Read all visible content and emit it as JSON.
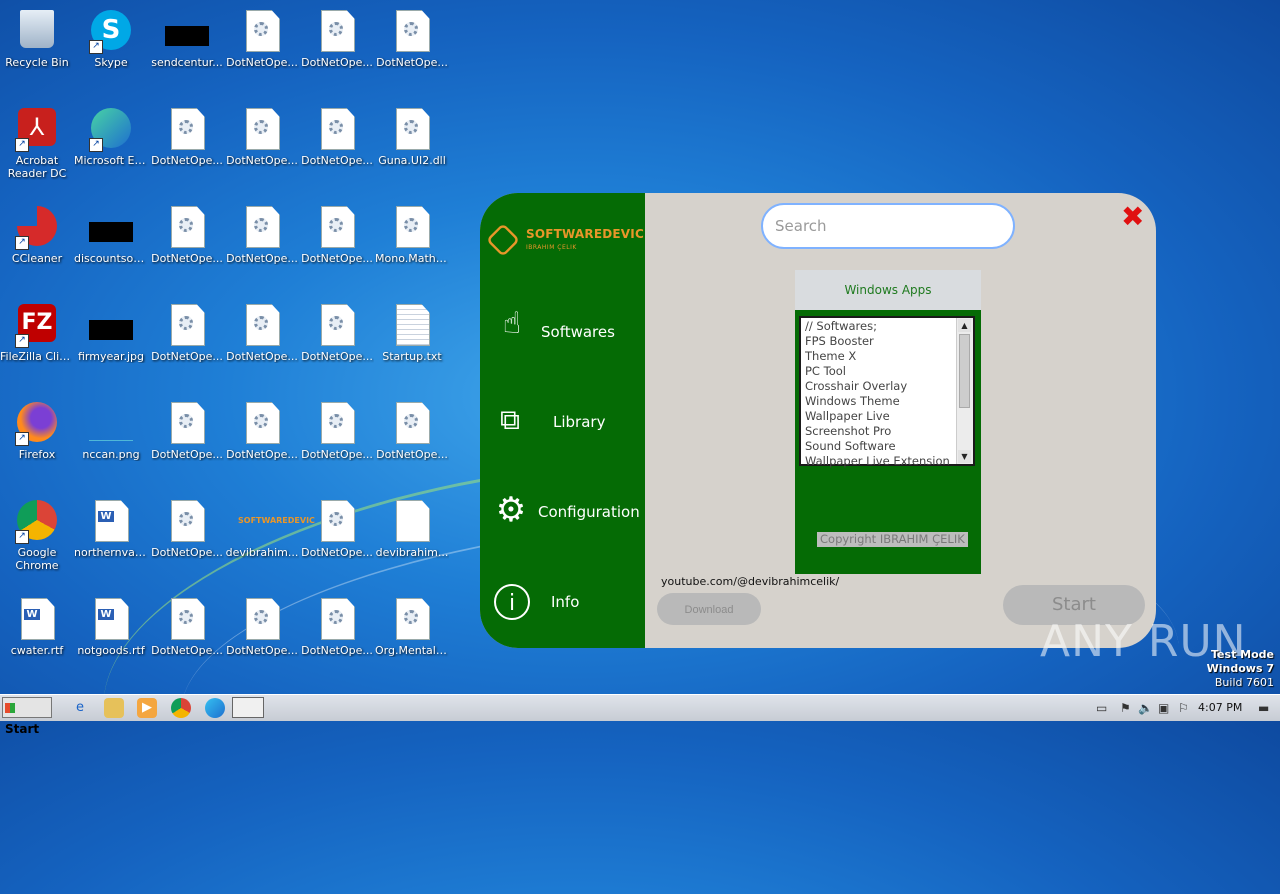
{
  "desktop": {
    "icons": [
      {
        "label": "Recycle Bin",
        "icon": "recycle-bin-icon"
      },
      {
        "label": "Skype",
        "icon": "skype-icon"
      },
      {
        "label": "sendcentur...",
        "icon": "image-file-icon"
      },
      {
        "label": "DotNetOpe...",
        "icon": "dll-file-icon"
      },
      {
        "label": "DotNetOpe...",
        "icon": "dll-file-icon"
      },
      {
        "label": "DotNetOpe...",
        "icon": "dll-file-icon"
      },
      {
        "label": "Acrobat Reader DC",
        "icon": "acrobat-icon"
      },
      {
        "label": "Microsoft Edge",
        "icon": "edge-icon"
      },
      {
        "label": "DotNetOpe...",
        "icon": "dll-file-icon"
      },
      {
        "label": "DotNetOpe...",
        "icon": "dll-file-icon"
      },
      {
        "label": "DotNetOpe...",
        "icon": "dll-file-icon"
      },
      {
        "label": "Guna.UI2.dll",
        "icon": "dll-file-icon"
      },
      {
        "label": "CCleaner",
        "icon": "ccleaner-icon"
      },
      {
        "label": "discountsom...",
        "icon": "image-file-icon"
      },
      {
        "label": "DotNetOpe...",
        "icon": "dll-file-icon"
      },
      {
        "label": "DotNetOpe...",
        "icon": "dll-file-icon"
      },
      {
        "label": "DotNetOpe...",
        "icon": "dll-file-icon"
      },
      {
        "label": "Mono.Math.dll",
        "icon": "dll-file-icon"
      },
      {
        "label": "FileZilla Client",
        "icon": "filezilla-icon"
      },
      {
        "label": "firmyear.jpg",
        "icon": "image-file-icon"
      },
      {
        "label": "DotNetOpe...",
        "icon": "dll-file-icon"
      },
      {
        "label": "DotNetOpe...",
        "icon": "dll-file-icon"
      },
      {
        "label": "DotNetOpe...",
        "icon": "dll-file-icon"
      },
      {
        "label": "Startup.txt",
        "icon": "text-file-icon"
      },
      {
        "label": "Firefox",
        "icon": "firefox-icon"
      },
      {
        "label": "nccan.png",
        "icon": "image-file-icon"
      },
      {
        "label": "DotNetOpe...",
        "icon": "dll-file-icon"
      },
      {
        "label": "DotNetOpe...",
        "icon": "dll-file-icon"
      },
      {
        "label": "DotNetOpe...",
        "icon": "dll-file-icon"
      },
      {
        "label": "DotNetOpe...",
        "icon": "dll-file-icon"
      },
      {
        "label": "Google Chrome",
        "icon": "chrome-icon"
      },
      {
        "label": "northernva.rtf",
        "icon": "word-doc-icon"
      },
      {
        "label": "DotNetOpe...",
        "icon": "dll-file-icon"
      },
      {
        "label": "devibrahim...",
        "icon": "image-file-icon"
      },
      {
        "label": "DotNetOpe...",
        "icon": "dll-file-icon"
      },
      {
        "label": "devibrahim...",
        "icon": "blank-file-icon"
      },
      {
        "label": "cwater.rtf",
        "icon": "word-doc-icon"
      },
      {
        "label": "notgoods.rtf",
        "icon": "word-doc-icon"
      },
      {
        "label": "DotNetOpe...",
        "icon": "dll-file-icon"
      },
      {
        "label": "DotNetOpe...",
        "icon": "dll-file-icon"
      },
      {
        "label": "DotNetOpe...",
        "icon": "dll-file-icon"
      },
      {
        "label": "Org.Mentali...",
        "icon": "dll-file-icon"
      }
    ]
  },
  "app": {
    "brand": {
      "name": "SOFTWAREDEVIC",
      "subtitle": "IBRAHIM ÇELIK",
      "logo_icon": "hexagon-logo-icon"
    },
    "nav": [
      {
        "label": "Softwares",
        "icon": "touch-hand-icon"
      },
      {
        "label": "Library",
        "icon": "puzzle-icon"
      },
      {
        "label": "Configuration",
        "icon": "gear-icon"
      },
      {
        "label": "Info",
        "icon": "info-icon"
      }
    ],
    "search": {
      "placeholder": "Search",
      "value": ""
    },
    "close_label": "✖",
    "panel": {
      "header": "Windows Apps",
      "list": [
        "// Softwares;",
        "FPS Booster",
        "Theme X",
        "PC Tool",
        "Crosshair Overlay",
        "Windows Theme",
        "Wallpaper Live",
        "Screenshot Pro",
        "Sound Software",
        "Wallpaper Live Extension"
      ],
      "copyright": "Copyright IBRAHIM ÇELIK"
    },
    "youtube": "youtube.com/@devibrahimcelik/",
    "download_label": "Download",
    "start_label": "Start",
    "accent_green": "#056b05",
    "brand_orange": "#e8962a"
  },
  "watermark": {
    "text": "ANY RUN"
  },
  "test_mode": {
    "line1": "Test Mode",
    "line2": "Windows 7",
    "line3": "Build 7601"
  },
  "taskbar": {
    "start_label": "Start",
    "pinned": [
      "ie-icon",
      "explorer-icon",
      "media-player-icon",
      "chrome-icon",
      "edge-icon",
      "app-window-icon"
    ],
    "clock": "4:07 PM"
  }
}
